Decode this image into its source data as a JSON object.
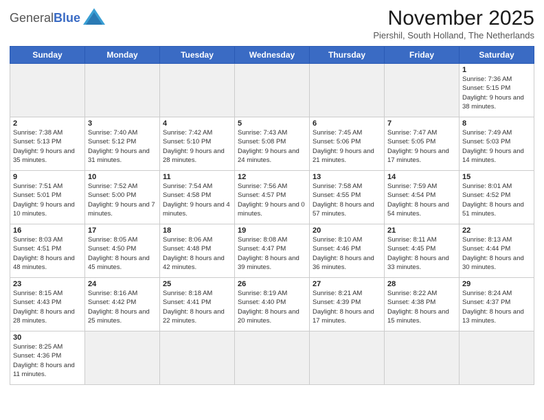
{
  "header": {
    "logo_text_general": "General",
    "logo_text_blue": "Blue",
    "month_title": "November 2025",
    "location": "Piershil, South Holland, The Netherlands"
  },
  "weekdays": [
    "Sunday",
    "Monday",
    "Tuesday",
    "Wednesday",
    "Thursday",
    "Friday",
    "Saturday"
  ],
  "weeks": [
    [
      {
        "num": "",
        "info": "",
        "empty": true
      },
      {
        "num": "",
        "info": "",
        "empty": true
      },
      {
        "num": "",
        "info": "",
        "empty": true
      },
      {
        "num": "",
        "info": "",
        "empty": true
      },
      {
        "num": "",
        "info": "",
        "empty": true
      },
      {
        "num": "",
        "info": "",
        "empty": true
      },
      {
        "num": "1",
        "info": "Sunrise: 7:36 AM\nSunset: 5:15 PM\nDaylight: 9 hours\nand 38 minutes.",
        "empty": false
      }
    ],
    [
      {
        "num": "2",
        "info": "Sunrise: 7:38 AM\nSunset: 5:13 PM\nDaylight: 9 hours\nand 35 minutes.",
        "empty": false
      },
      {
        "num": "3",
        "info": "Sunrise: 7:40 AM\nSunset: 5:12 PM\nDaylight: 9 hours\nand 31 minutes.",
        "empty": false
      },
      {
        "num": "4",
        "info": "Sunrise: 7:42 AM\nSunset: 5:10 PM\nDaylight: 9 hours\nand 28 minutes.",
        "empty": false
      },
      {
        "num": "5",
        "info": "Sunrise: 7:43 AM\nSunset: 5:08 PM\nDaylight: 9 hours\nand 24 minutes.",
        "empty": false
      },
      {
        "num": "6",
        "info": "Sunrise: 7:45 AM\nSunset: 5:06 PM\nDaylight: 9 hours\nand 21 minutes.",
        "empty": false
      },
      {
        "num": "7",
        "info": "Sunrise: 7:47 AM\nSunset: 5:05 PM\nDaylight: 9 hours\nand 17 minutes.",
        "empty": false
      },
      {
        "num": "8",
        "info": "Sunrise: 7:49 AM\nSunset: 5:03 PM\nDaylight: 9 hours\nand 14 minutes.",
        "empty": false
      }
    ],
    [
      {
        "num": "9",
        "info": "Sunrise: 7:51 AM\nSunset: 5:01 PM\nDaylight: 9 hours\nand 10 minutes.",
        "empty": false
      },
      {
        "num": "10",
        "info": "Sunrise: 7:52 AM\nSunset: 5:00 PM\nDaylight: 9 hours\nand 7 minutes.",
        "empty": false
      },
      {
        "num": "11",
        "info": "Sunrise: 7:54 AM\nSunset: 4:58 PM\nDaylight: 9 hours\nand 4 minutes.",
        "empty": false
      },
      {
        "num": "12",
        "info": "Sunrise: 7:56 AM\nSunset: 4:57 PM\nDaylight: 9 hours\nand 0 minutes.",
        "empty": false
      },
      {
        "num": "13",
        "info": "Sunrise: 7:58 AM\nSunset: 4:55 PM\nDaylight: 8 hours\nand 57 minutes.",
        "empty": false
      },
      {
        "num": "14",
        "info": "Sunrise: 7:59 AM\nSunset: 4:54 PM\nDaylight: 8 hours\nand 54 minutes.",
        "empty": false
      },
      {
        "num": "15",
        "info": "Sunrise: 8:01 AM\nSunset: 4:52 PM\nDaylight: 8 hours\nand 51 minutes.",
        "empty": false
      }
    ],
    [
      {
        "num": "16",
        "info": "Sunrise: 8:03 AM\nSunset: 4:51 PM\nDaylight: 8 hours\nand 48 minutes.",
        "empty": false
      },
      {
        "num": "17",
        "info": "Sunrise: 8:05 AM\nSunset: 4:50 PM\nDaylight: 8 hours\nand 45 minutes.",
        "empty": false
      },
      {
        "num": "18",
        "info": "Sunrise: 8:06 AM\nSunset: 4:48 PM\nDaylight: 8 hours\nand 42 minutes.",
        "empty": false
      },
      {
        "num": "19",
        "info": "Sunrise: 8:08 AM\nSunset: 4:47 PM\nDaylight: 8 hours\nand 39 minutes.",
        "empty": false
      },
      {
        "num": "20",
        "info": "Sunrise: 8:10 AM\nSunset: 4:46 PM\nDaylight: 8 hours\nand 36 minutes.",
        "empty": false
      },
      {
        "num": "21",
        "info": "Sunrise: 8:11 AM\nSunset: 4:45 PM\nDaylight: 8 hours\nand 33 minutes.",
        "empty": false
      },
      {
        "num": "22",
        "info": "Sunrise: 8:13 AM\nSunset: 4:44 PM\nDaylight: 8 hours\nand 30 minutes.",
        "empty": false
      }
    ],
    [
      {
        "num": "23",
        "info": "Sunrise: 8:15 AM\nSunset: 4:43 PM\nDaylight: 8 hours\nand 28 minutes.",
        "empty": false
      },
      {
        "num": "24",
        "info": "Sunrise: 8:16 AM\nSunset: 4:42 PM\nDaylight: 8 hours\nand 25 minutes.",
        "empty": false
      },
      {
        "num": "25",
        "info": "Sunrise: 8:18 AM\nSunset: 4:41 PM\nDaylight: 8 hours\nand 22 minutes.",
        "empty": false
      },
      {
        "num": "26",
        "info": "Sunrise: 8:19 AM\nSunset: 4:40 PM\nDaylight: 8 hours\nand 20 minutes.",
        "empty": false
      },
      {
        "num": "27",
        "info": "Sunrise: 8:21 AM\nSunset: 4:39 PM\nDaylight: 8 hours\nand 17 minutes.",
        "empty": false
      },
      {
        "num": "28",
        "info": "Sunrise: 8:22 AM\nSunset: 4:38 PM\nDaylight: 8 hours\nand 15 minutes.",
        "empty": false
      },
      {
        "num": "29",
        "info": "Sunrise: 8:24 AM\nSunset: 4:37 PM\nDaylight: 8 hours\nand 13 minutes.",
        "empty": false
      }
    ],
    [
      {
        "num": "30",
        "info": "Sunrise: 8:25 AM\nSunset: 4:36 PM\nDaylight: 8 hours\nand 11 minutes.",
        "empty": false
      },
      {
        "num": "",
        "info": "",
        "empty": true
      },
      {
        "num": "",
        "info": "",
        "empty": true
      },
      {
        "num": "",
        "info": "",
        "empty": true
      },
      {
        "num": "",
        "info": "",
        "empty": true
      },
      {
        "num": "",
        "info": "",
        "empty": true
      },
      {
        "num": "",
        "info": "",
        "empty": true
      }
    ]
  ]
}
